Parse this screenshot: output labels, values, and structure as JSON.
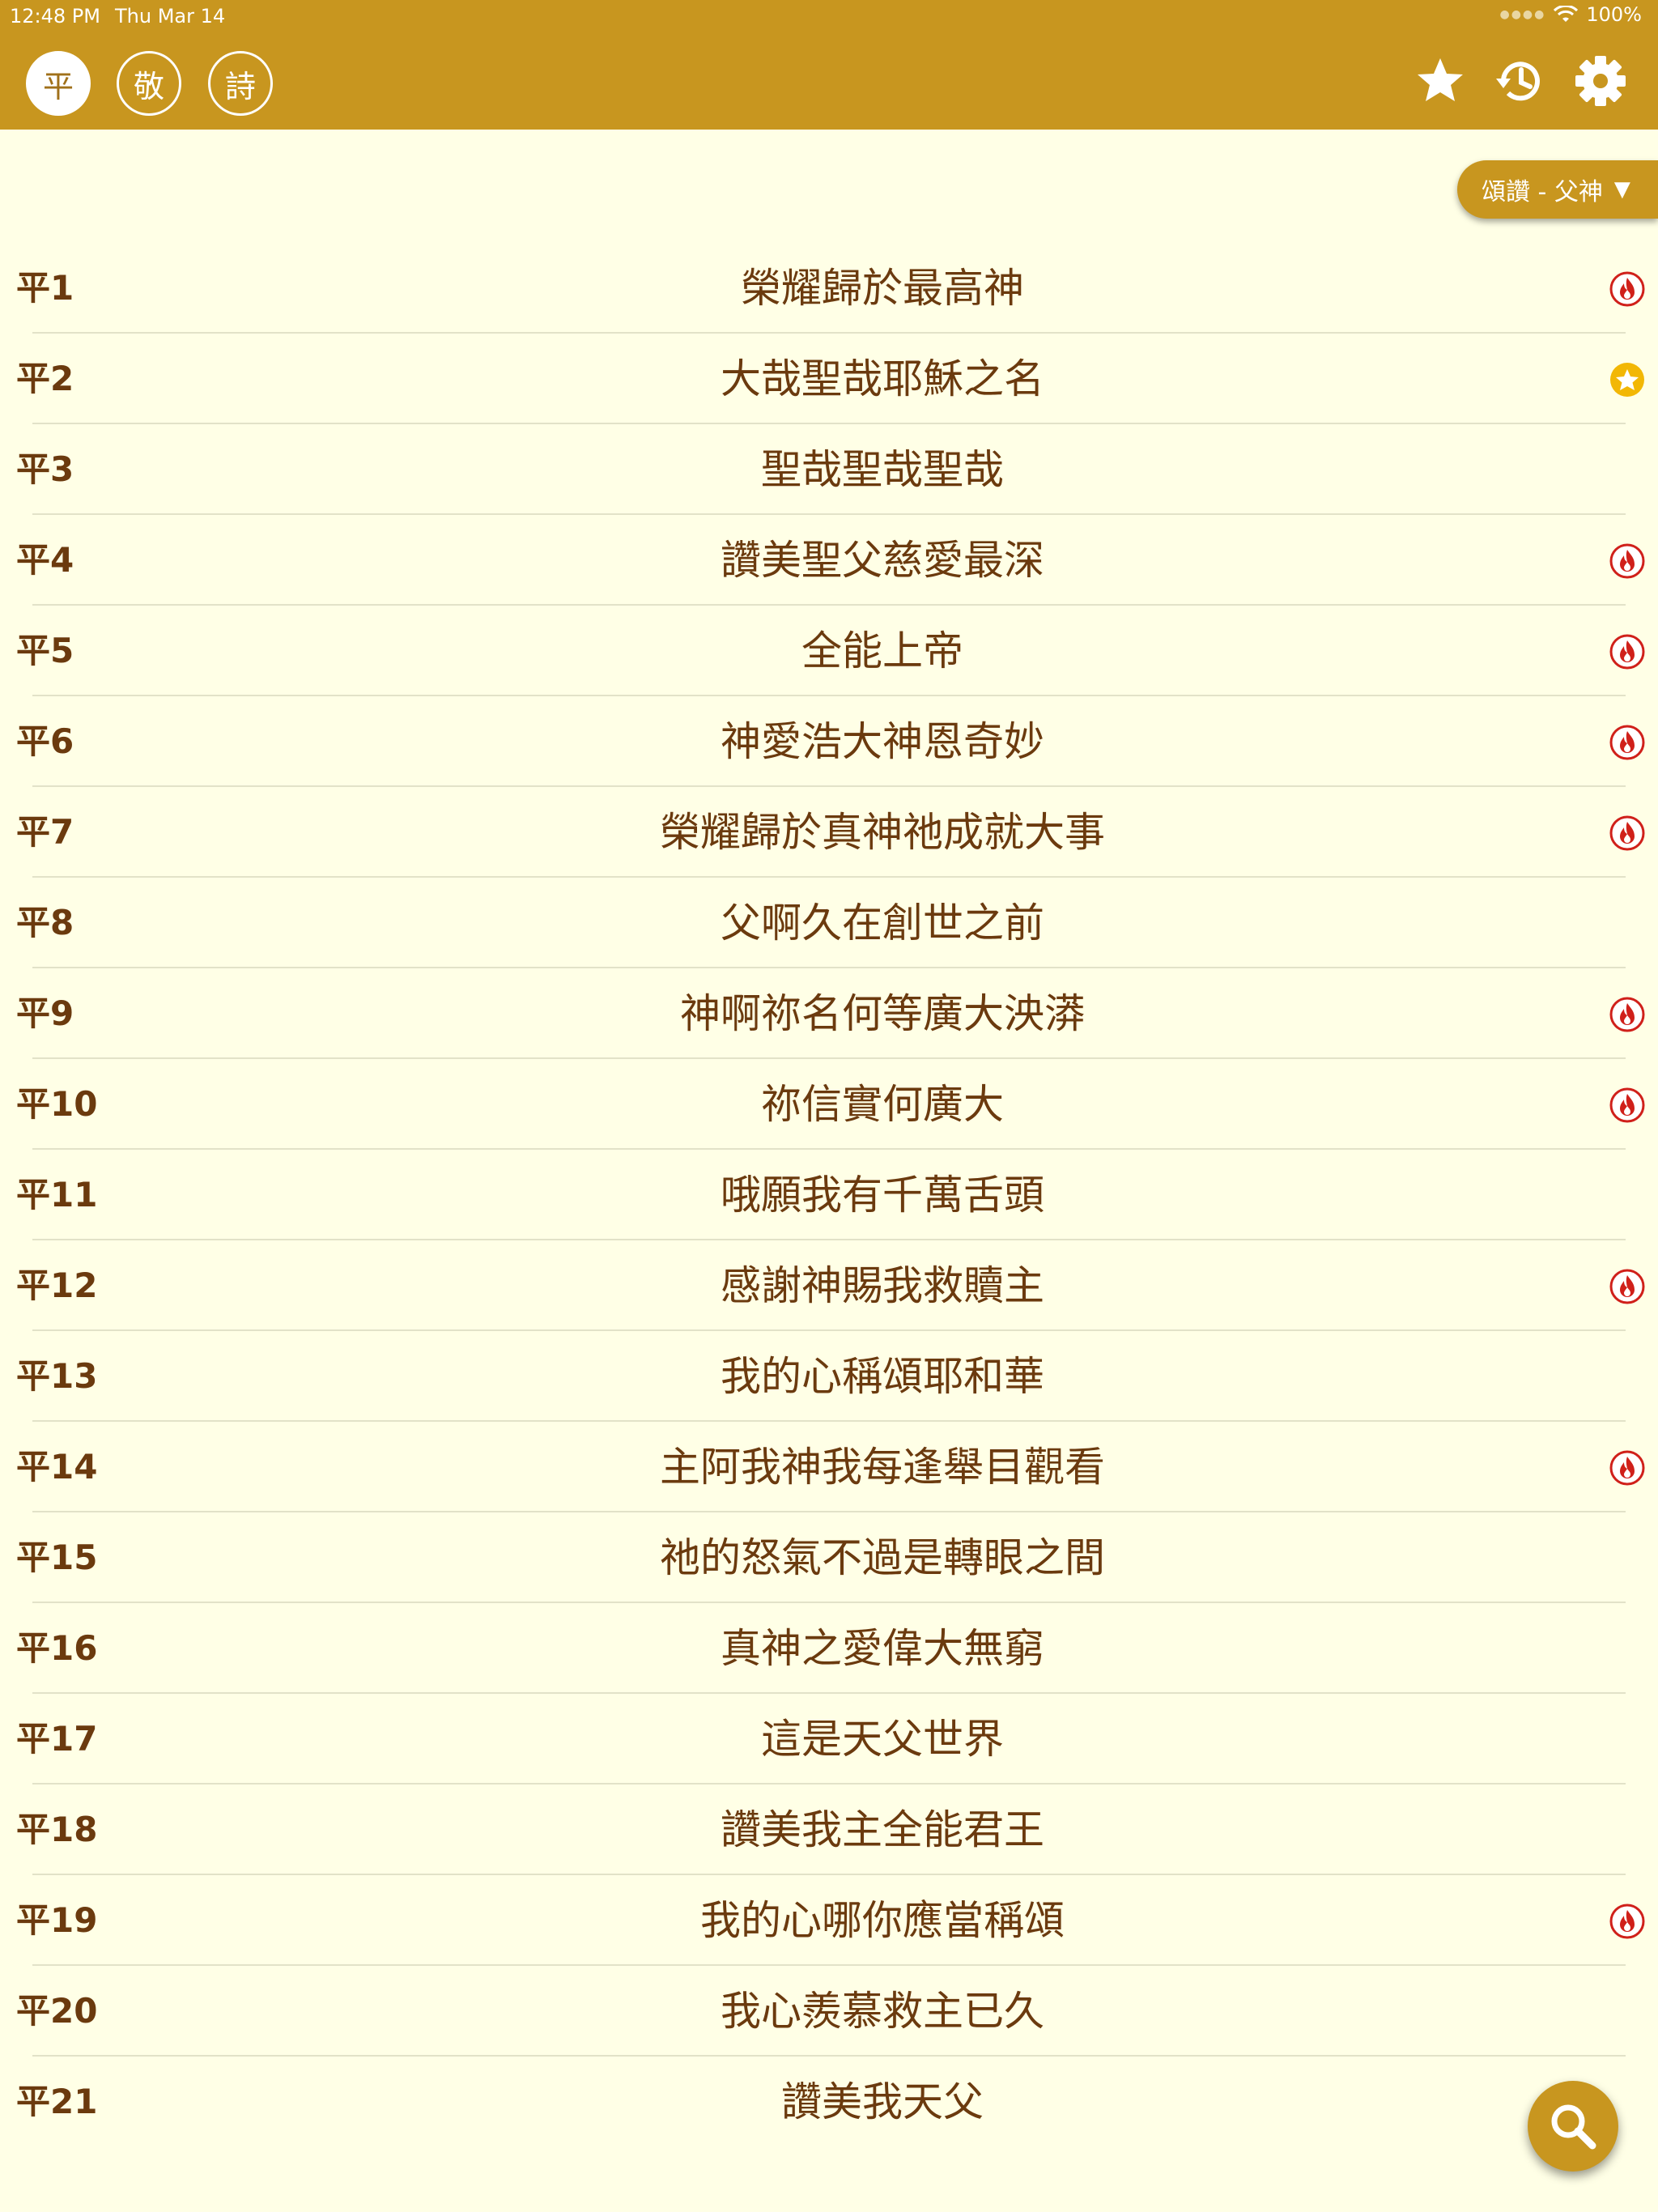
{
  "status_bar": {
    "time": "12:48 PM",
    "date": "Thu Mar 14",
    "battery": "100%"
  },
  "colors": {
    "accent": "#C8961F",
    "background": "#FFFFE6",
    "text": "#6B3A0E",
    "fire": "#D0201A",
    "star_badge": "#F2B705"
  },
  "header": {
    "tabs": [
      {
        "label": "平",
        "active": true
      },
      {
        "label": "敬",
        "active": false
      },
      {
        "label": "詩",
        "active": false
      }
    ],
    "icons": [
      "star-icon",
      "history-icon",
      "gear-icon"
    ]
  },
  "filter": {
    "label": "頌讚 - 父神",
    "caret": "▼"
  },
  "hymns": [
    {
      "number": "平1",
      "title": "榮耀歸於最高神",
      "badge": "fire"
    },
    {
      "number": "平2",
      "title": "大哉聖哉耶穌之名",
      "badge": "star"
    },
    {
      "number": "平3",
      "title": "聖哉聖哉聖哉",
      "badge": ""
    },
    {
      "number": "平4",
      "title": "讚美聖父慈愛最深",
      "badge": "fire"
    },
    {
      "number": "平5",
      "title": "全能上帝",
      "badge": "fire"
    },
    {
      "number": "平6",
      "title": "神愛浩大神恩奇妙",
      "badge": "fire"
    },
    {
      "number": "平7",
      "title": "榮耀歸於真神祂成就大事",
      "badge": "fire"
    },
    {
      "number": "平8",
      "title": "父啊久在創世之前",
      "badge": ""
    },
    {
      "number": "平9",
      "title": "神啊祢名何等廣大泱漭",
      "badge": "fire"
    },
    {
      "number": "平10",
      "title": "祢信實何廣大",
      "badge": "fire"
    },
    {
      "number": "平11",
      "title": "哦願我有千萬舌頭",
      "badge": ""
    },
    {
      "number": "平12",
      "title": "感謝神賜我救贖主",
      "badge": "fire"
    },
    {
      "number": "平13",
      "title": "我的心稱頌耶和華",
      "badge": ""
    },
    {
      "number": "平14",
      "title": "主阿我神我每逢舉目觀看",
      "badge": "fire"
    },
    {
      "number": "平15",
      "title": "祂的怒氣不過是轉眼之間",
      "badge": ""
    },
    {
      "number": "平16",
      "title": "真神之愛偉大無窮",
      "badge": ""
    },
    {
      "number": "平17",
      "title": "這是天父世界",
      "badge": ""
    },
    {
      "number": "平18",
      "title": "讚美我主全能君王",
      "badge": ""
    },
    {
      "number": "平19",
      "title": "我的心哪你應當稱頌",
      "badge": "fire"
    },
    {
      "number": "平20",
      "title": "我心羨慕救主已久",
      "badge": ""
    },
    {
      "number": "平21",
      "title": "讚美我天父",
      "badge": ""
    }
  ],
  "search": {
    "icon": "search-icon"
  }
}
